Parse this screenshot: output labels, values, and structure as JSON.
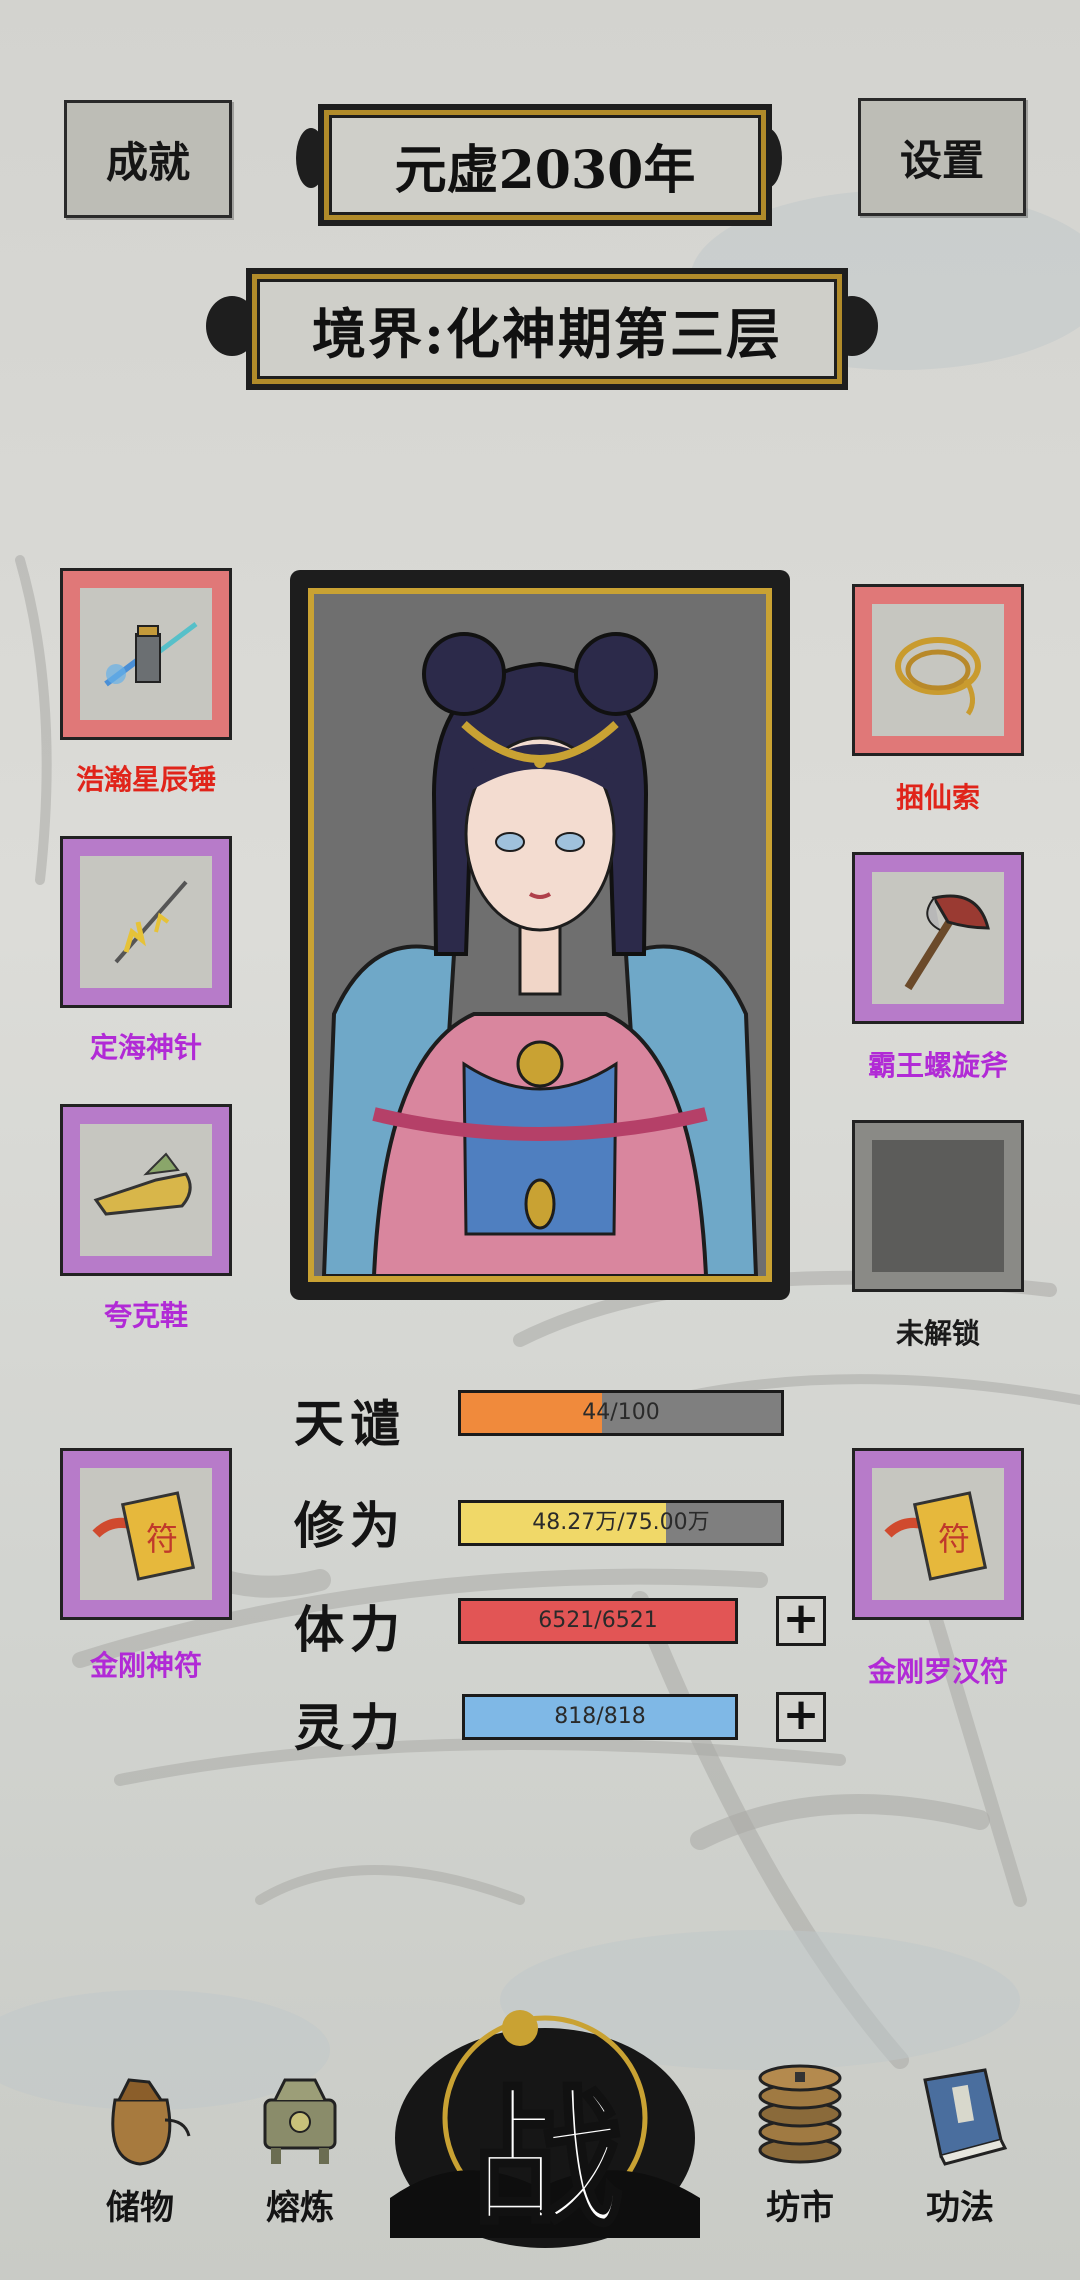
{
  "header": {
    "achievements_label": "成就",
    "year_label": "元虚2030年",
    "settings_label": "设置",
    "realm_label": "境界:化神期第三层"
  },
  "equipment": {
    "left": [
      {
        "name": "浩瀚星辰锤",
        "color": "#e0241a",
        "rarity": "red",
        "icon": "star-hammer-icon"
      },
      {
        "name": "定海神针",
        "color": "#b12ad6",
        "rarity": "purple",
        "icon": "sea-needle-icon"
      },
      {
        "name": "夸克鞋",
        "color": "#b12ad6",
        "rarity": "purple",
        "icon": "boots-icon"
      },
      {
        "name": "金刚神符",
        "color": "#b12ad6",
        "rarity": "purple",
        "icon": "talisman-icon"
      }
    ],
    "right": [
      {
        "name": "捆仙索",
        "color": "#e0241a",
        "rarity": "red",
        "icon": "rope-icon"
      },
      {
        "name": "霸王螺旋斧",
        "color": "#b12ad6",
        "rarity": "purple",
        "icon": "axe-icon"
      },
      {
        "name": "未解锁",
        "color": "#1a1a1a",
        "rarity": "locked",
        "icon": "locked-slot-icon"
      },
      {
        "name": "金刚罗汉符",
        "color": "#b12ad6",
        "rarity": "purple",
        "icon": "talisman-icon"
      }
    ]
  },
  "stats": [
    {
      "label": "天谴",
      "text": "44/100",
      "fraction": 0.44,
      "color": "#f08a3c"
    },
    {
      "label": "修为",
      "text": "48.27万/75.00万",
      "fraction": 0.64,
      "color": "#f0d868"
    },
    {
      "label": "体力",
      "text": "6521/6521",
      "fraction": 1.0,
      "color": "#e25555"
    },
    {
      "label": "灵力",
      "text": "818/818",
      "fraction": 1.0,
      "color": "#7fb8e6"
    }
  ],
  "stat_plus_symbol": "+",
  "nav": {
    "storage": "储物",
    "refine": "熔炼",
    "fight": "战",
    "market": "坊市",
    "skills": "功法"
  }
}
